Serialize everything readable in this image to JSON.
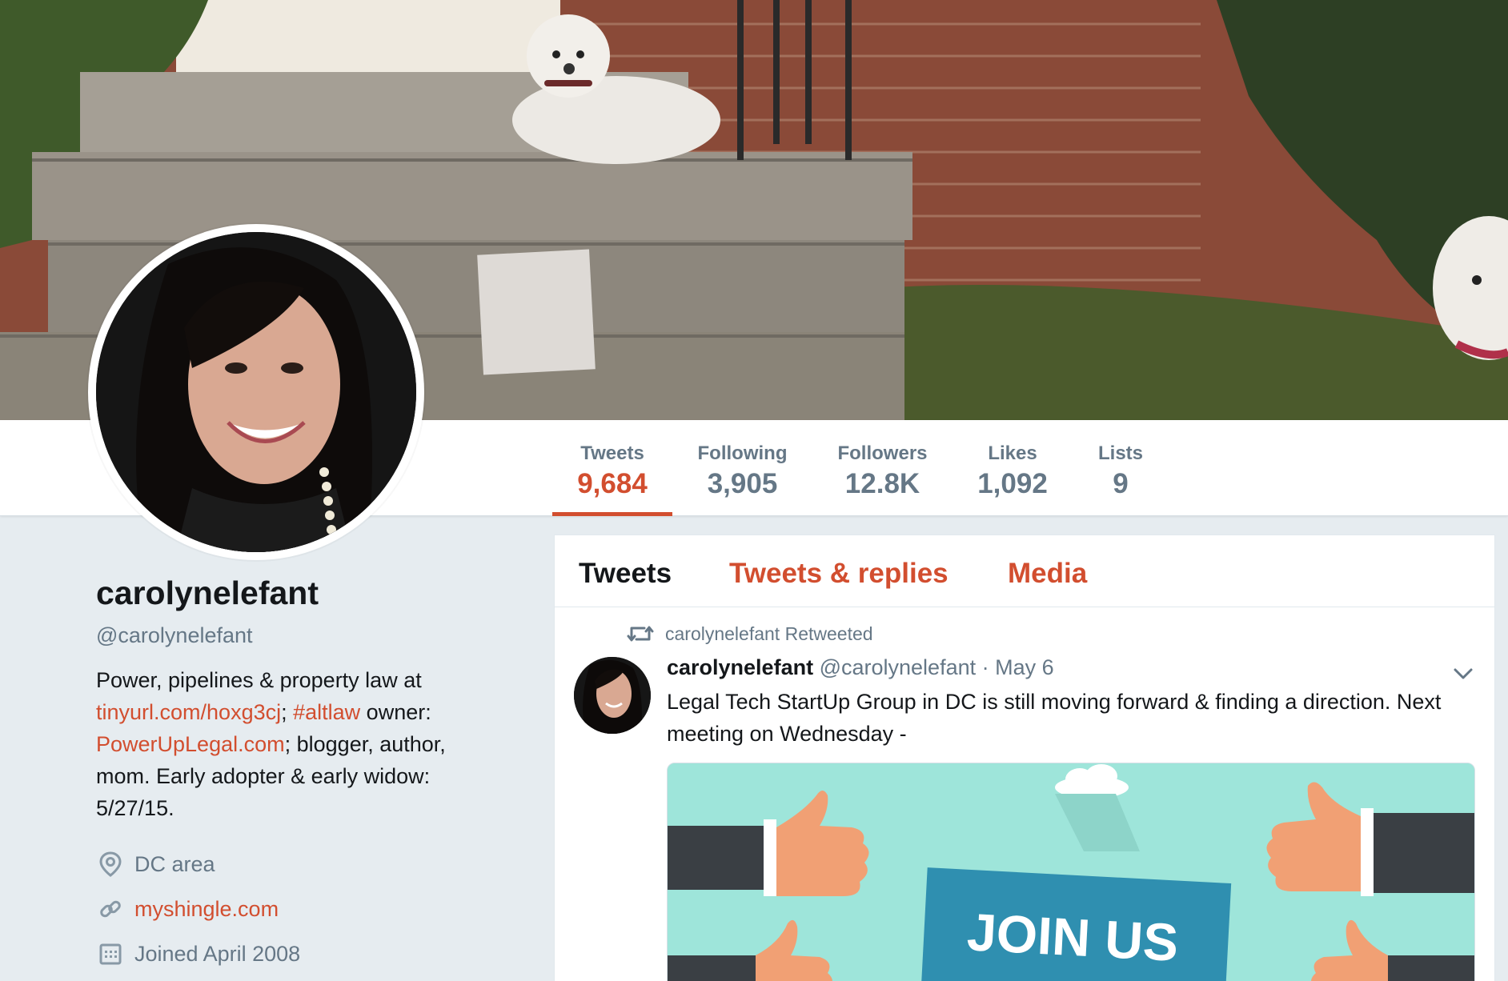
{
  "profile": {
    "name": "carolynelefant",
    "handle": "@carolynelefant",
    "bio": {
      "t1": "Power, pipelines & property law at ",
      "link1": "tinyurl.com/hoxg3cj",
      "t2": "; ",
      "link2": "#altlaw",
      "t3": " owner: ",
      "link3": "PowerUpLegal.com",
      "t4": "; blogger, author, mom. Early adopter & early widow: 5/27/15."
    },
    "location": "DC area",
    "website": "myshingle.com",
    "joined": "Joined April 2008"
  },
  "stats": [
    {
      "label": "Tweets",
      "value": "9,684",
      "active": true
    },
    {
      "label": "Following",
      "value": "3,905"
    },
    {
      "label": "Followers",
      "value": "12.8K"
    },
    {
      "label": "Likes",
      "value": "1,092"
    },
    {
      "label": "Lists",
      "value": "9"
    }
  ],
  "tabs": [
    {
      "label": "Tweets",
      "active": true
    },
    {
      "label": "Tweets & replies"
    },
    {
      "label": "Media"
    }
  ],
  "tweet": {
    "retweet_context": "carolynelefant Retweeted",
    "author_name": "carolynelefant",
    "author_handle": "@carolynelefant",
    "date": "· May 6",
    "text": "Legal Tech StartUp Group in DC is still moving forward & finding a direction. Next meeting on Wednesday -",
    "media_text": "JOIN US"
  },
  "icons": {
    "location": "location-pin-icon",
    "link": "link-icon",
    "calendar": "calendar-icon",
    "retweet": "retweet-icon",
    "caret": "chevron-down-icon"
  },
  "colors": {
    "accent": "#d24e2f",
    "muted": "#657786",
    "text": "#14171a",
    "background": "#e6ecf0"
  }
}
